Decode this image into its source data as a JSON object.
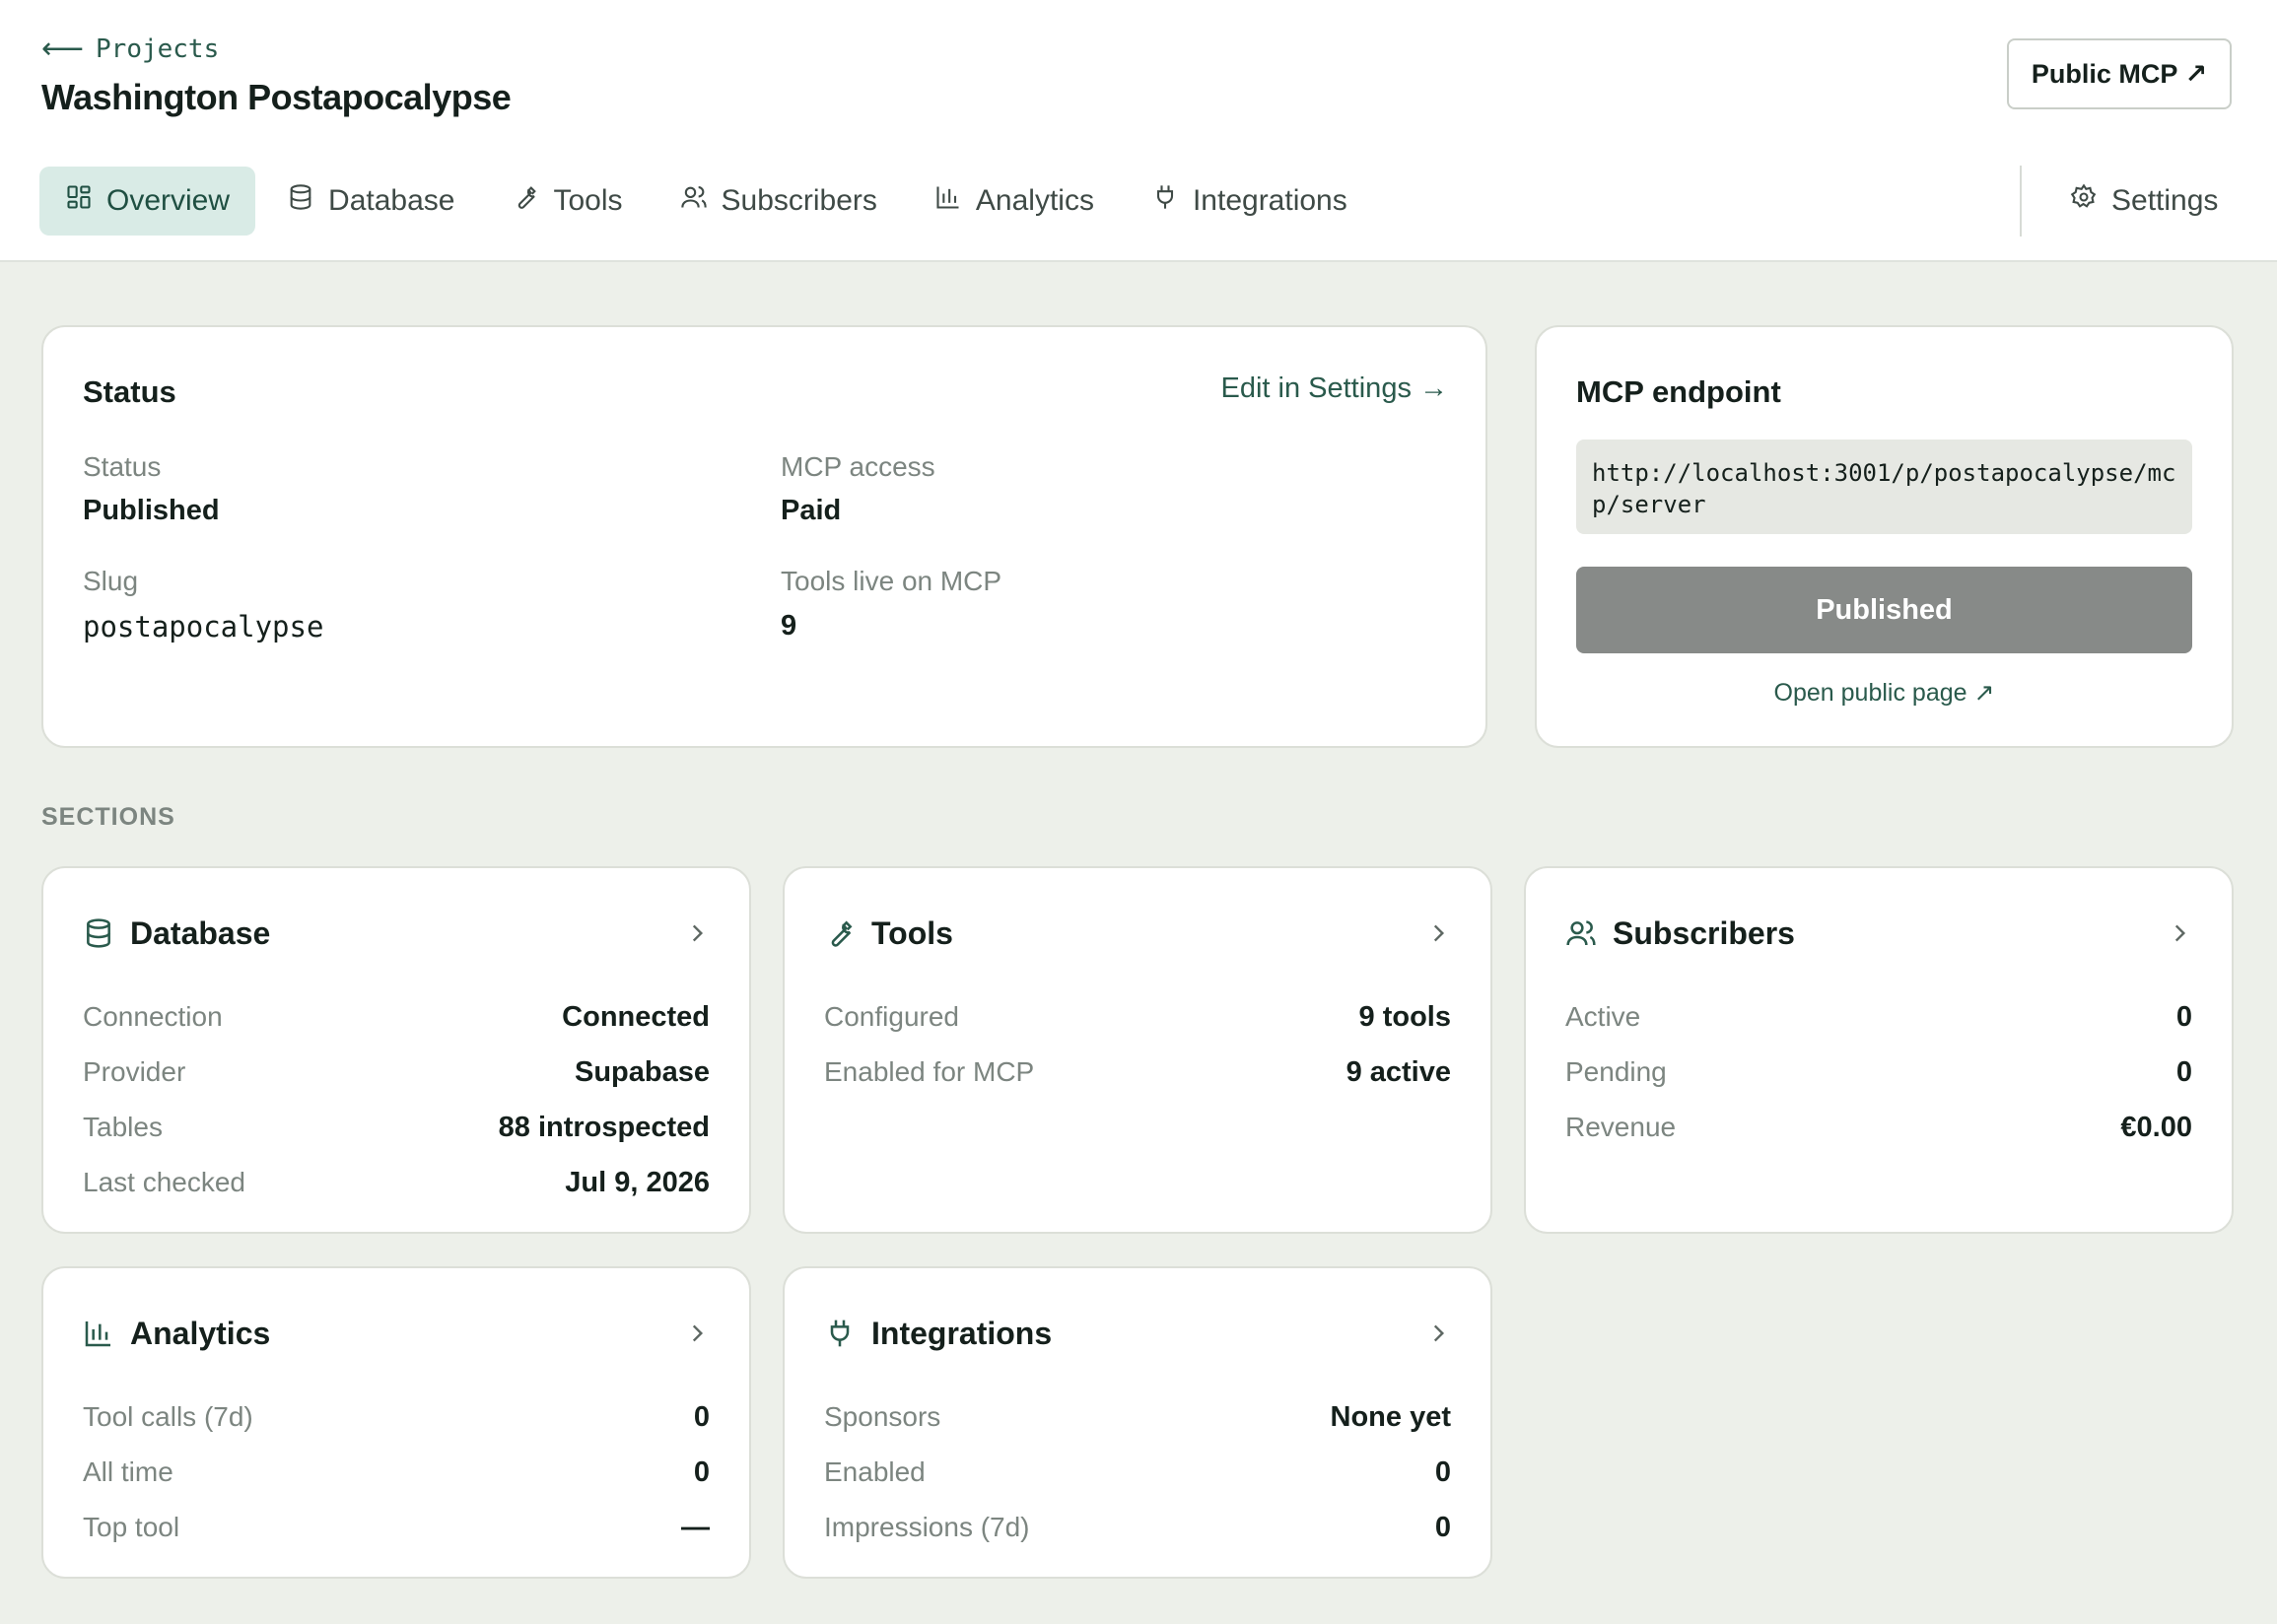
{
  "header": {
    "back_label": "Projects",
    "title": "Washington Postapocalypse",
    "public_mcp_label": "Public MCP ↗"
  },
  "nav": {
    "tabs": [
      {
        "label": "Overview",
        "icon": "grid-icon",
        "active": true
      },
      {
        "label": "Database",
        "icon": "database-icon"
      },
      {
        "label": "Tools",
        "icon": "wrench-icon"
      },
      {
        "label": "Subscribers",
        "icon": "users-icon"
      },
      {
        "label": "Analytics",
        "icon": "bar-chart-icon"
      },
      {
        "label": "Integrations",
        "icon": "plug-icon"
      }
    ],
    "settings_label": "Settings"
  },
  "status_card": {
    "heading": "Status",
    "edit_label": "Edit in Settings →",
    "status_label": "Status",
    "status_value": "Published",
    "access_label": "MCP access",
    "access_value": "Paid",
    "slug_label": "Slug",
    "slug_value": "postapocalypse",
    "tools_live_label": "Tools live on MCP",
    "tools_live_value": "9"
  },
  "endpoint_card": {
    "heading": "MCP endpoint",
    "url": "http://localhost:3001/p/postapocalypse/mcp/server",
    "button_label": "Published",
    "open_link_label": "Open public page ↗"
  },
  "sections_label": "SECTIONS",
  "sections": {
    "database": {
      "title": "Database",
      "rows": [
        {
          "k": "Connection",
          "v": "Connected"
        },
        {
          "k": "Provider",
          "v": "Supabase"
        },
        {
          "k": "Tables",
          "v": "88 introspected"
        },
        {
          "k": "Last checked",
          "v": "Jul 9, 2026"
        }
      ]
    },
    "tools": {
      "title": "Tools",
      "rows": [
        {
          "k": "Configured",
          "v": "9 tools"
        },
        {
          "k": "Enabled for MCP",
          "v": "9 active"
        }
      ]
    },
    "subscribers": {
      "title": "Subscribers",
      "rows": [
        {
          "k": "Active",
          "v": "0"
        },
        {
          "k": "Pending",
          "v": "0"
        },
        {
          "k": "Revenue",
          "v": "€0.00"
        }
      ]
    },
    "analytics": {
      "title": "Analytics",
      "rows": [
        {
          "k": "Tool calls (7d)",
          "v": "0"
        },
        {
          "k": "All time",
          "v": "0"
        },
        {
          "k": "Top tool",
          "v": "—"
        }
      ]
    },
    "integrations": {
      "title": "Integrations",
      "rows": [
        {
          "k": "Sponsors",
          "v": "None yet"
        },
        {
          "k": "Enabled",
          "v": "0"
        },
        {
          "k": "Impressions (7d)",
          "v": "0"
        }
      ]
    }
  },
  "colors": {
    "accent": "#2a5a4c",
    "active_tab_bg": "#d9ebe6",
    "page_bg": "#edf0ea",
    "published_button": "#878a88"
  }
}
